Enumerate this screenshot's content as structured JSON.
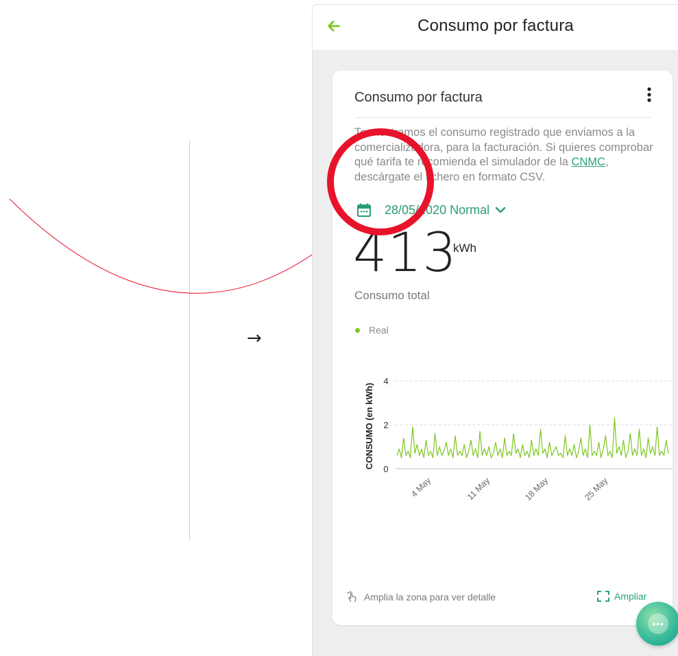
{
  "header": {
    "title": "Consumo por factura"
  },
  "card": {
    "title": "Consumo por factura",
    "description_before": "Te mostramos el consumo registrado que enviamos a la comercializadora, para la facturación. Si quieres comprobar qué tarifa te recomienda el simulador de la ",
    "link_text": "CNMC",
    "description_after": ", descárgate el fichero en formato CSV.",
    "date_label": "28/05/2020 Normal",
    "total_value": "413",
    "total_unit": "kWh",
    "total_label": "Consumo total",
    "legend_label": "Real",
    "zoom_hint": "Amplia la zona para ver detalle",
    "expand_label": "Ampliar"
  },
  "colors": {
    "accent": "#2aa37b",
    "series": "#7bc61e",
    "annotation": "#e8132b"
  },
  "icons": [
    "arrow-back-icon",
    "more-vert-icon",
    "calendar-icon",
    "chevron-down-icon",
    "touch-hand-icon",
    "expand-icon",
    "chat-icon"
  ],
  "decor": {
    "arrow": "→"
  },
  "chart_data": {
    "type": "line",
    "ylabel": "CONSUMO (en kWh)",
    "ylim": [
      0,
      4
    ],
    "yticks": [
      "0",
      "2",
      "4"
    ],
    "x_tick_labels": [
      "4 May",
      "11 May",
      "18 May",
      "25 May"
    ],
    "grid": true,
    "series": [
      {
        "name": "Real",
        "values": [
          0.6,
          0.9,
          0.5,
          1.4,
          0.6,
          0.8,
          0.5,
          1.9,
          0.7,
          1.1,
          0.6,
          0.9,
          0.5,
          1.3,
          0.6,
          0.8,
          0.5,
          1.6,
          0.6,
          1.0,
          0.6,
          0.8,
          1.2,
          0.6,
          0.9,
          0.5,
          1.5,
          0.6,
          0.8,
          0.6,
          1.1,
          0.5,
          0.8,
          1.3,
          0.6,
          0.9,
          0.5,
          1.7,
          0.6,
          0.9,
          0.6,
          1.0,
          0.5,
          0.7,
          1.2,
          0.6,
          0.9,
          0.5,
          1.4,
          0.6,
          0.8,
          0.6,
          1.6,
          0.7,
          0.9,
          0.5,
          1.1,
          0.6,
          0.8,
          0.5,
          1.3,
          0.6,
          0.9,
          0.6,
          1.8,
          0.7,
          0.9,
          0.5,
          1.2,
          0.6,
          0.8,
          1.0,
          0.6,
          0.7,
          0.5,
          1.5,
          0.6,
          0.9,
          0.6,
          1.1,
          0.5,
          0.8,
          1.4,
          0.6,
          0.9,
          0.5,
          2.0,
          0.6,
          0.8,
          0.6,
          1.2,
          0.5,
          0.9,
          1.5,
          0.6,
          0.8,
          0.5,
          2.3,
          0.7,
          1.0,
          0.6,
          1.3,
          0.5,
          0.8,
          1.6,
          0.6,
          0.9,
          0.6,
          1.8,
          0.6,
          0.9,
          0.5,
          1.4,
          0.7,
          1.0,
          0.6,
          1.9,
          0.6,
          0.8,
          0.6,
          1.3,
          0.7
        ]
      }
    ]
  }
}
